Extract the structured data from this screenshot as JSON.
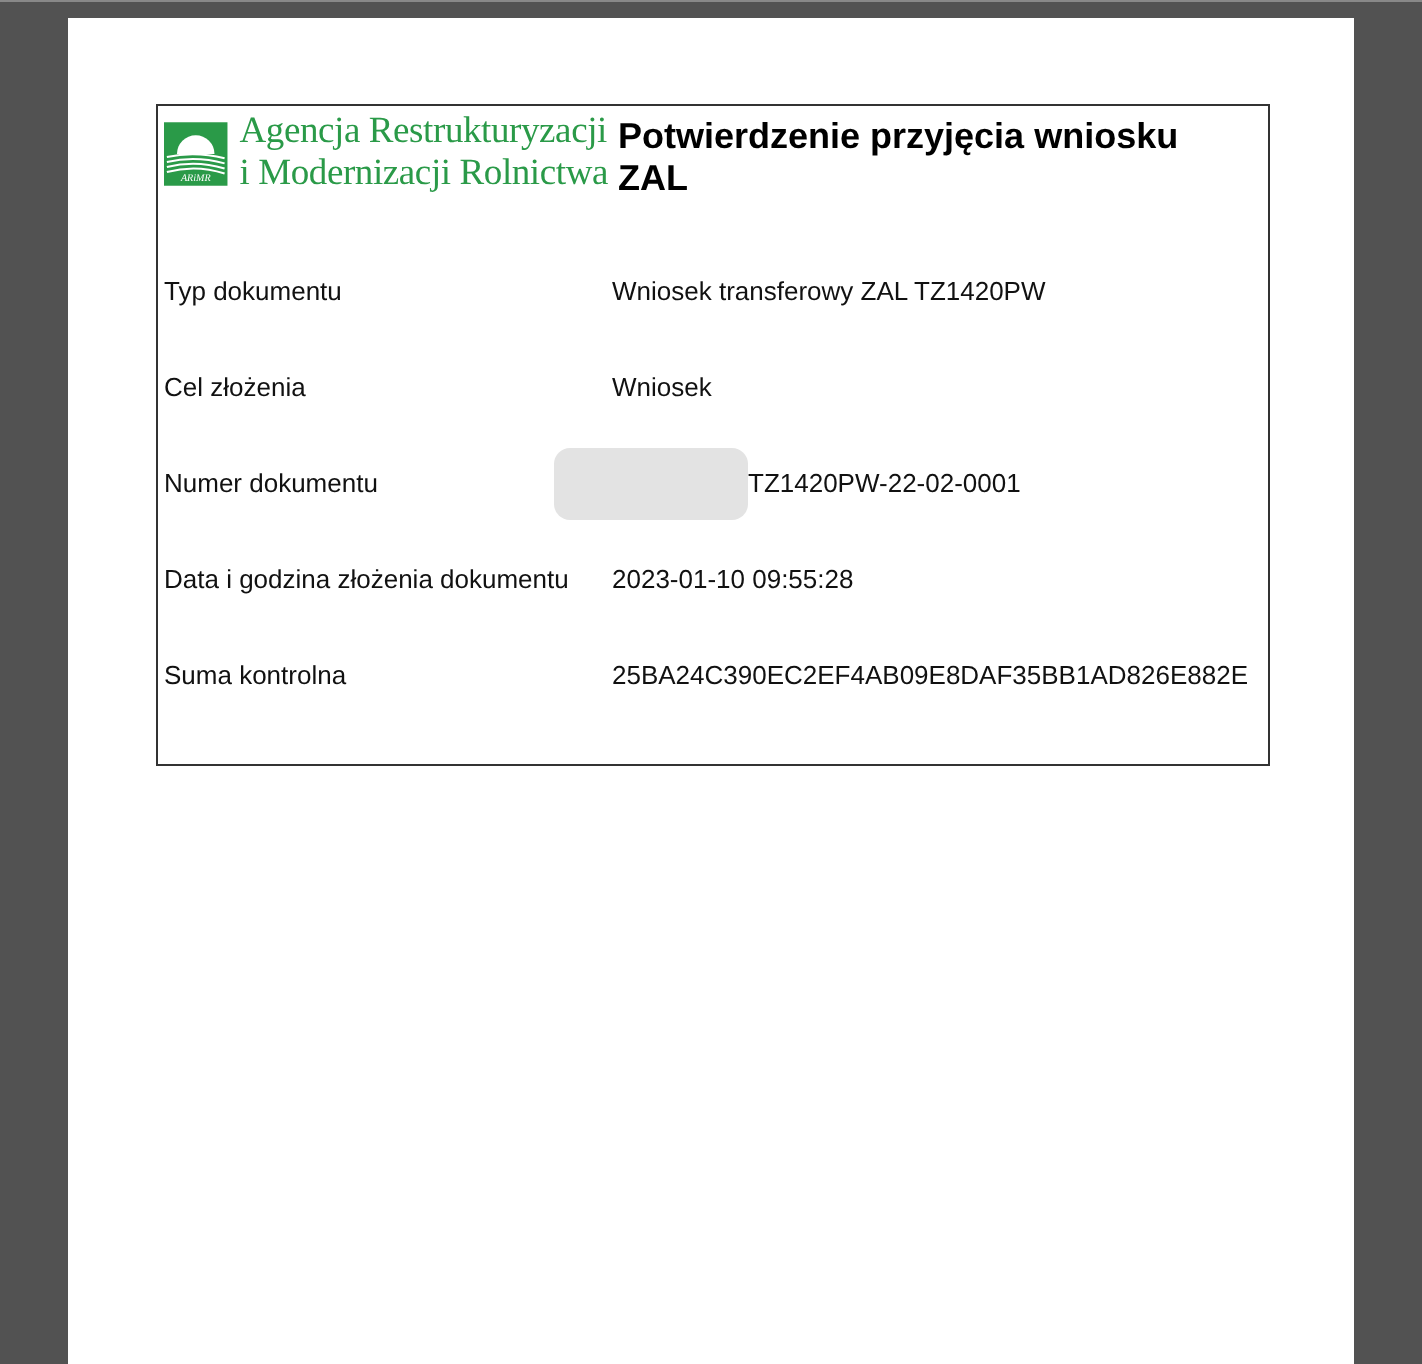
{
  "logo": {
    "mark_text": "ARiMR",
    "agency_lines": [
      "Agencja Restrukturyzacji",
      "i Modernizacji Rolnictwa"
    ]
  },
  "title": "Potwierdzenie przyjęcia wniosku ZAL",
  "rows": [
    {
      "label": "Typ dokumentu",
      "value": "Wniosek transferowy ZAL TZ1420PW",
      "redacted": false
    },
    {
      "label": "Cel złożenia",
      "value": "Wniosek",
      "redacted": false
    },
    {
      "label": "Numer dokumentu",
      "value": "TZ1420PW-22-02-0001",
      "redacted": true
    },
    {
      "label": "Data i godzina złożenia dokumentu",
      "value": "2023-01-10 09:55:28",
      "redacted": false
    },
    {
      "label": "Suma kontrolna",
      "value": "25BA24C390EC2EF4AB09E8DAF35BB1AD826E882E",
      "redacted": false
    }
  ]
}
